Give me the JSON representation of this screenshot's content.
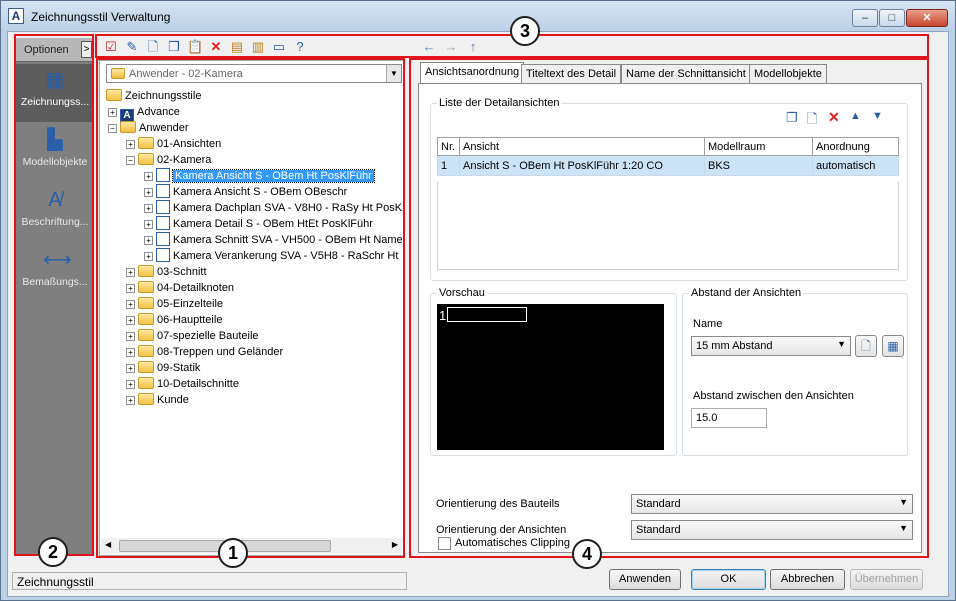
{
  "window": {
    "title": "Zeichnungsstil Verwaltung",
    "controls": [
      "–",
      "□",
      "✕"
    ]
  },
  "sidebar": {
    "options_label": "Optionen",
    "options_arrow": ">",
    "items": [
      {
        "label": "Zeichnungss...",
        "icon": "drawing-style-icon"
      },
      {
        "label": "Modellobjekte",
        "icon": "model-objects-icon"
      },
      {
        "label": "Beschriftung...",
        "icon": "annotation-icon"
      },
      {
        "label": "Bemaßungs...",
        "icon": "dimension-icon"
      }
    ]
  },
  "toolbar": {
    "icons": [
      "check-icon",
      "edit-icon",
      "new-icon",
      "copy-icon",
      "paste-icon",
      "delete-icon",
      "import-icon",
      "export-icon",
      "display-icon",
      "help-icon"
    ],
    "nav": [
      "←",
      "→",
      "↑"
    ]
  },
  "tree": {
    "combo_value": "Anwender - 02-Kamera",
    "root": "Zeichnungsstile",
    "nodes": [
      {
        "label": "Advance",
        "level": 1,
        "exp": "+",
        "kind": "logo"
      },
      {
        "label": "Anwender",
        "level": 1,
        "exp": "−",
        "kind": "folder"
      },
      {
        "label": "01-Ansichten",
        "level": 2,
        "exp": "+",
        "kind": "folder"
      },
      {
        "label": "02-Kamera",
        "level": 2,
        "exp": "−",
        "kind": "folder"
      },
      {
        "label": "Kamera Ansicht S - OBem Ht PosKlFühr",
        "level": 3,
        "exp": "+",
        "kind": "doc",
        "selected": true
      },
      {
        "label": "Kamera Ansicht S - OBem OBeschr",
        "level": 3,
        "exp": "+",
        "kind": "doc"
      },
      {
        "label": "Kamera Dachplan SVA - V8H0 - RaSy Ht PosK",
        "level": 3,
        "exp": "+",
        "kind": "doc"
      },
      {
        "label": "Kamera Detail S - OBem HtEt PosKlFühr",
        "level": 3,
        "exp": "+",
        "kind": "doc"
      },
      {
        "label": "Kamera Schnitt SVA - VH500 - OBem Ht Name",
        "level": 3,
        "exp": "+",
        "kind": "doc"
      },
      {
        "label": "Kamera Verankerung SVA - V5H8 - RaSchr Ht",
        "level": 3,
        "exp": "+",
        "kind": "doc"
      },
      {
        "label": "03-Schnitt",
        "level": 2,
        "exp": "+",
        "kind": "folder"
      },
      {
        "label": "04-Detailknoten",
        "level": 2,
        "exp": "+",
        "kind": "folder"
      },
      {
        "label": "05-Einzelteile",
        "level": 2,
        "exp": "+",
        "kind": "folder"
      },
      {
        "label": "06-Hauptteile",
        "level": 2,
        "exp": "+",
        "kind": "folder"
      },
      {
        "label": "07-spezielle Bauteile",
        "level": 2,
        "exp": "+",
        "kind": "folder"
      },
      {
        "label": "08-Treppen und Geländer",
        "level": 2,
        "exp": "+",
        "kind": "folder"
      },
      {
        "label": "09-Statik",
        "level": 2,
        "exp": "+",
        "kind": "folder"
      },
      {
        "label": "10-Detailschnitte",
        "level": 2,
        "exp": "+",
        "kind": "folder"
      },
      {
        "label": "Kunde",
        "level": 2,
        "exp": "+",
        "kind": "folder"
      }
    ]
  },
  "tabs": [
    "Ansichtsanordnung",
    "Titeltext des Detail",
    "Name der Schnittansicht",
    "Modellobjekte"
  ],
  "detail_list": {
    "group_label": "Liste der Detailansichten",
    "columns": [
      "Nr.",
      "Ansicht",
      "Modellraum",
      "Anordnung"
    ],
    "rows": [
      [
        "1",
        "Ansicht S - OBem Ht PosKlFühr 1:20 CO",
        "BKS",
        "automatisch"
      ]
    ]
  },
  "preview": {
    "label": "Vorschau",
    "item_number": "1"
  },
  "spacing": {
    "group_label": "Abstand der Ansichten",
    "name_label": "Name",
    "name_value": "15 mm Abstand",
    "between_label": "Abstand zwischen den Ansichten",
    "between_value": "15.0"
  },
  "orientation": {
    "part_label": "Orientierung des Bauteils",
    "part_value": "Standard",
    "views_label": "Orientierung der Ansichten",
    "views_value": "Standard"
  },
  "clipping_label": "Automatisches Clipping",
  "status_text": "Zeichnungsstil",
  "buttons": {
    "apply": "Anwenden",
    "ok": "OK",
    "cancel": "Abbrechen",
    "take": "Übernehmen"
  },
  "callouts": [
    "1",
    "2",
    "3",
    "4"
  ]
}
